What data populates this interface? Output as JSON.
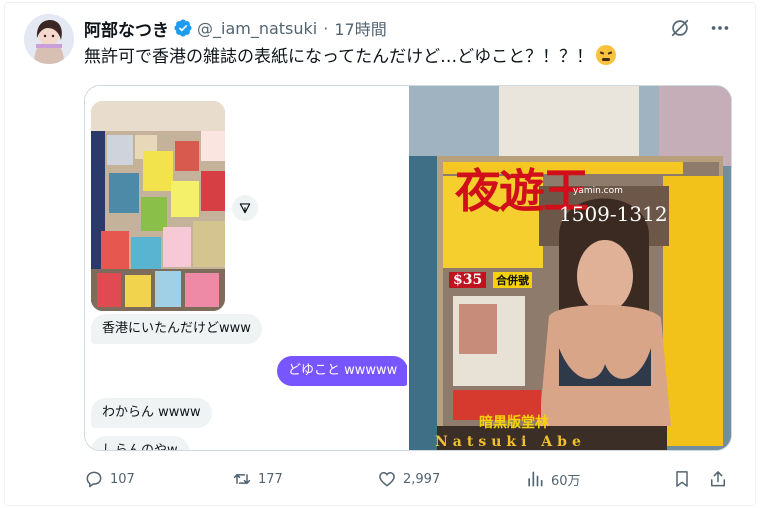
{
  "author": {
    "display_name": "阿部なつき",
    "handle": "@_iam_natsuki",
    "separator": "·",
    "time": "17時間"
  },
  "tweet": {
    "text": "無許可で香港の雑誌の表紙になってたんだけど…どゆこと？！？！"
  },
  "media": {
    "dm_messages": [
      {
        "text": "香港にいたんだけどwww",
        "direction": "incoming"
      },
      {
        "text": "どゆこと wwwww",
        "direction": "outgoing"
      },
      {
        "text": "わからん wwww",
        "direction": "incoming"
      },
      {
        "text": "しらんのやw",
        "direction": "incoming"
      }
    ],
    "magazine": {
      "title": "夜遊王",
      "number": "1509-1312",
      "url": "yamin.com",
      "price": "$35",
      "issue": "合併號",
      "subtitle": "暗黒版堂林",
      "cover_name": "Natsuki Abe"
    }
  },
  "actions": {
    "replies": "107",
    "retweets": "177",
    "likes": "2,997",
    "views": "60万"
  },
  "icons": [
    "verified-badge-icon",
    "grok-icon",
    "more-icon",
    "reply-icon",
    "retweet-icon",
    "like-icon",
    "views-icon",
    "bookmark-icon",
    "share-icon",
    "dm-share-icon"
  ],
  "colors": {
    "text_primary": "#0f1419",
    "text_secondary": "#536471",
    "verified_blue": "#1d9bf0",
    "dm_outgoing": "#7856ff",
    "dm_incoming": "#eff3f4",
    "border": "#cfd9de"
  }
}
